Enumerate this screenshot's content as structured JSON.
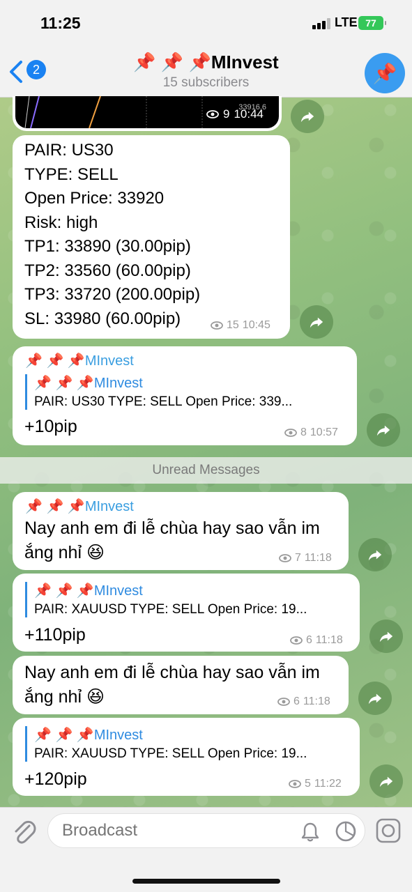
{
  "status_bar": {
    "time": "11:25",
    "network": "LTE",
    "battery": "77"
  },
  "header": {
    "back_count": "2",
    "title": "📌 📌 📌MInvest",
    "subtitle": "15 subscribers",
    "avatar_icon": "pushpin-icon"
  },
  "image_message": {
    "chart_label": "33916.6",
    "views": "9",
    "time": "10:44"
  },
  "signal_message": {
    "lines": [
      "PAIR: US30",
      "TYPE: SELL",
      "Open Price: 33920",
      "Risk: high",
      "TP1: 33890 (30.00pip)",
      "TP2: 33560 (60.00pip)",
      "TP3: 33720 (200.00pip)",
      "SL: 33980 (60.00pip)"
    ],
    "views": "15",
    "time": "10:45"
  },
  "reply_message_1": {
    "sender": "📌 📌 📌MInvest",
    "quote_sender": "📌 📌 📌MInvest",
    "quote_text": "PAIR: US30  TYPE: SELL  Open Price: 339...",
    "text": "+10pip",
    "views": "8",
    "time": "10:57"
  },
  "unread_label": "Unread Messages",
  "text_message_1": {
    "sender": "📌 📌 📌MInvest",
    "line1": "Nay anh em đi lễ chùa hay sao vẫn im",
    "line2": "ắng nhỉ 😆",
    "views": "7",
    "time": "11:18"
  },
  "reply_message_2": {
    "quote_sender": "📌 📌 📌MInvest",
    "quote_text": "PAIR: XAUUSD TYPE: SELL Open Price: 19...",
    "text": "+110pip",
    "views": "6",
    "time": "11:18"
  },
  "text_message_2": {
    "line1": "Nay anh em đi lễ chùa hay sao vẫn im",
    "line2": "ắng nhỉ 😆",
    "views": "6",
    "time": "11:18"
  },
  "reply_message_3": {
    "quote_sender": "📌 📌 📌MInvest",
    "quote_text": "PAIR: XAUUSD TYPE: SELL Open Price: 19...",
    "text": "+120pip",
    "views": "5",
    "time": "11:22"
  },
  "bottom_bar": {
    "placeholder": "Broadcast"
  },
  "colors": {
    "accent": "#1a82f2",
    "sender": "#3a9ee0",
    "battery": "#34c759"
  }
}
